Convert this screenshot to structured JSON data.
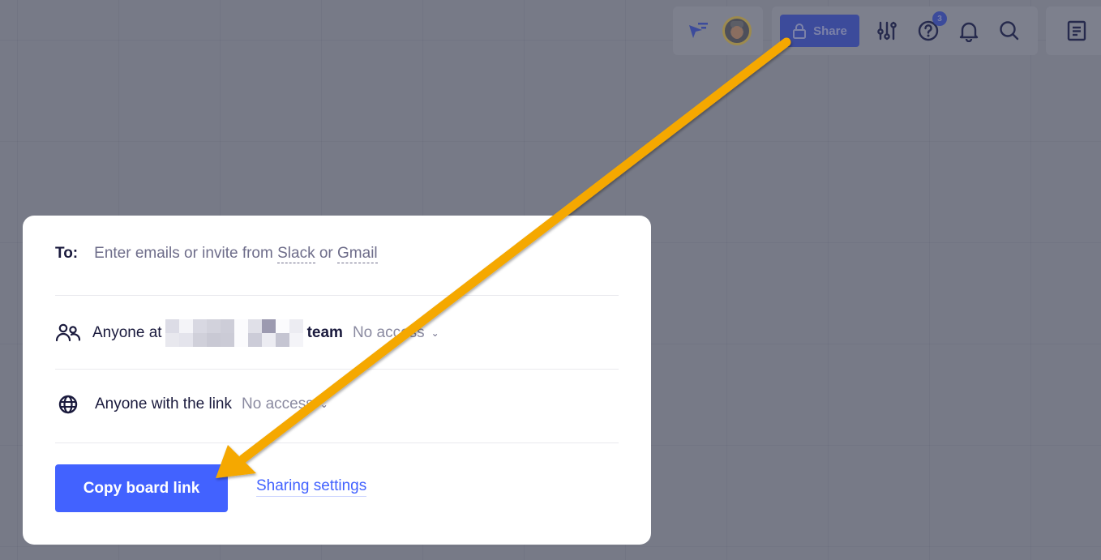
{
  "toolbar": {
    "collaborators": {
      "cursor_icon": "cursor-filter-icon",
      "avatar_alt": "User avatar"
    },
    "share_label": "Share",
    "share_icon": "lock-icon",
    "icons": [
      "settings-sliders-icon",
      "help-icon",
      "bell-icon",
      "search-icon"
    ],
    "help_badge": "3",
    "notes_icon": "notes-icon"
  },
  "share_dialog": {
    "to_label": "To:",
    "to_placeholder_prefix": "Enter emails or invite from ",
    "slack_link": "Slack",
    "or": " or ",
    "gmail_link": "Gmail",
    "team_row": {
      "prefix": "Anyone at",
      "suffix": "team",
      "access": "No access"
    },
    "link_row": {
      "label": "Anyone with the link",
      "access": "No access"
    },
    "copy_button": "Copy board link",
    "settings_link": "Sharing settings"
  },
  "colors": {
    "primary": "#4262ff",
    "annotation_arrow": "#f5a800",
    "overlay": "#777a87"
  }
}
